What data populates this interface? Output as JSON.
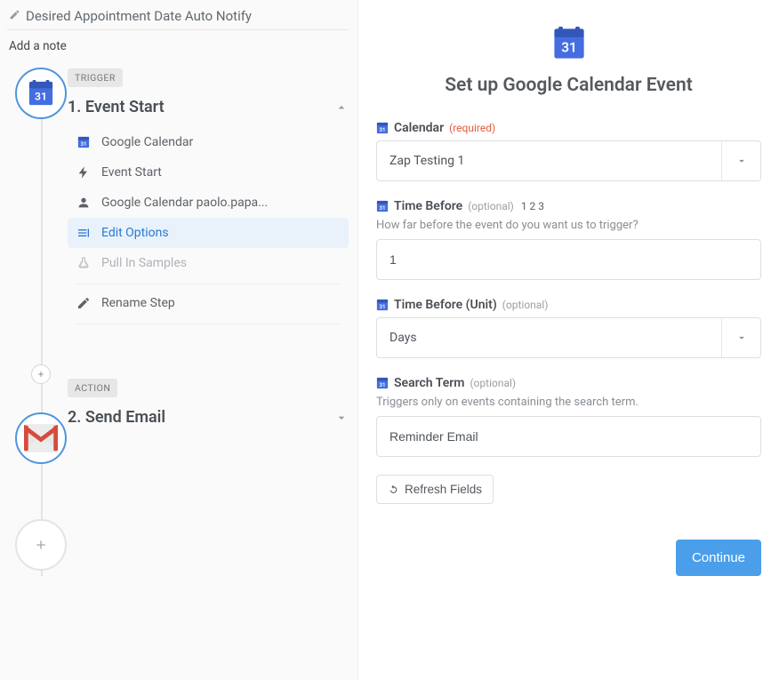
{
  "zap": {
    "title": "Desired Appointment Date Auto Notify",
    "add_note": "Add a note"
  },
  "step1": {
    "badge": "TRIGGER",
    "title": "1. Event Start",
    "rows": {
      "app": "Google Calendar",
      "event": "Event Start",
      "account": "Google Calendar paolo.papa...",
      "edit": "Edit Options",
      "samples": "Pull In Samples",
      "rename": "Rename Step"
    }
  },
  "step2": {
    "badge": "ACTION",
    "title": "2. Send Email"
  },
  "right": {
    "heading": "Set up Google Calendar Event",
    "fields": {
      "calendar": {
        "label": "Calendar",
        "req": "(required)",
        "value": "Zap Testing 1"
      },
      "time_before": {
        "label": "Time Before",
        "opt": "(optional)",
        "extra": "1 2 3",
        "help": "How far before the event do you want us to trigger?",
        "value": "1"
      },
      "time_unit": {
        "label": "Time Before (Unit)",
        "opt": "(optional)",
        "value": "Days"
      },
      "search": {
        "label": "Search Term",
        "opt": "(optional)",
        "help": "Triggers only on events containing the search term.",
        "value": "Reminder Email"
      }
    },
    "refresh": "Refresh Fields",
    "continue": "Continue"
  },
  "icons": {
    "gcal_day": "31"
  }
}
